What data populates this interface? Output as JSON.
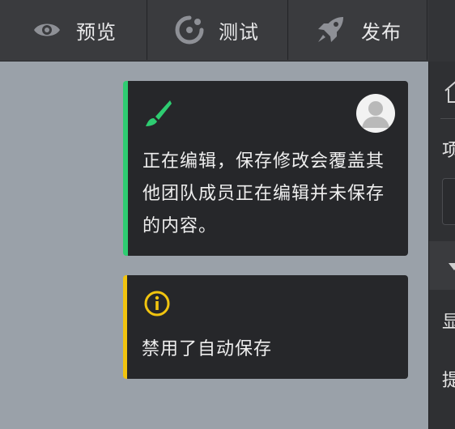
{
  "toolbar": {
    "preview_label": "预览",
    "test_label": "测试",
    "publish_label": "发布"
  },
  "notices": {
    "editing_text": "正在编辑，保存修改会覆盖其他团队成员正在编辑并未保存的内容。",
    "autosave_text": "禁用了自动保存"
  },
  "sidebar": {
    "label_1": "项",
    "label_2": "显",
    "label_3": "提"
  },
  "icons": {
    "preview": "eye-icon",
    "test": "test-icon",
    "publish": "rocket-icon",
    "editing": "brush-icon",
    "user": "avatar-icon",
    "warning": "info-icon",
    "home": "home-icon",
    "collapse": "chevron-down-icon"
  },
  "colors": {
    "editing_accent": "#2ecc71",
    "warning_accent": "#f1c40f"
  }
}
